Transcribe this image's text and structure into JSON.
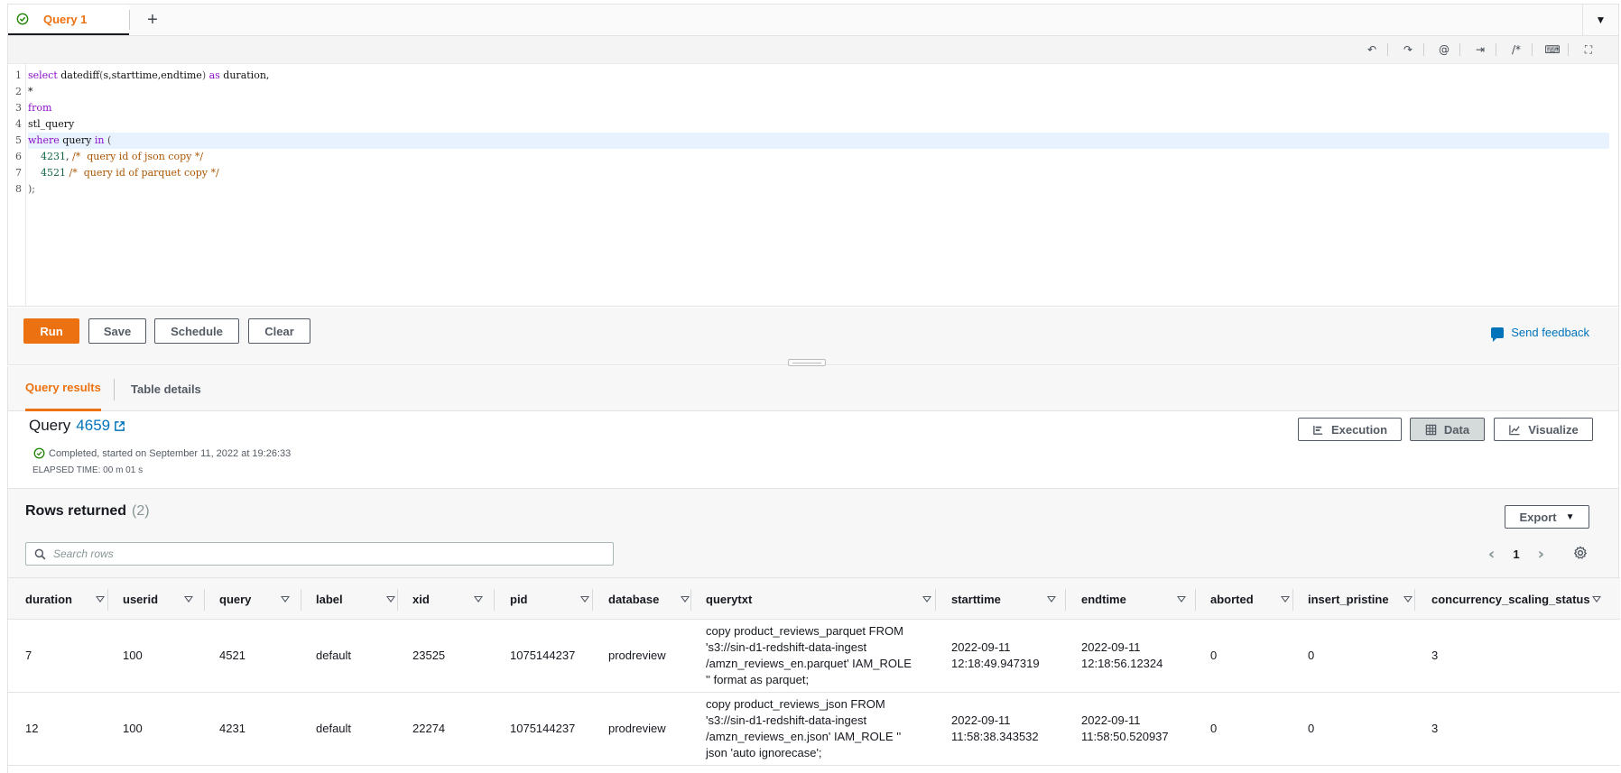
{
  "tabs": {
    "active_label": "Query 1",
    "add_label": "+",
    "menu_label": "▼"
  },
  "editor": {
    "toolbar": {
      "undo": "↶",
      "redo": "↷",
      "at": "@",
      "indent": "⇥",
      "comment": "/*",
      "keyboard": "⌨",
      "fullscreen": "⛶"
    },
    "lines": [
      {
        "num": "1"
      },
      {
        "num": "2"
      },
      {
        "num": "3"
      },
      {
        "num": "4"
      },
      {
        "num": "5"
      },
      {
        "num": "6"
      },
      {
        "num": "7"
      },
      {
        "num": "8"
      }
    ],
    "code": {
      "l1_kw1": "select",
      "l1_fn": " datediff",
      "l1_open": "(",
      "l1_args": "s,starttime,endtime",
      "l1_close": ")",
      "l1_as": " as",
      "l1_rest": " duration,",
      "l2": "*",
      "l3_kw": "from",
      "l4": "stl_query",
      "l5_kw1": "where",
      "l5_mid": " query ",
      "l5_kw2": "in",
      "l5_paren": " (",
      "l6_num": "4231",
      "l6_comma": ", ",
      "l6_cmt": "/*  query id of json copy */",
      "l7_num": "4521",
      "l7_cmt": " /*  query id of parquet copy */",
      "l8": ");"
    }
  },
  "actions": {
    "run": "Run",
    "save": "Save",
    "schedule": "Schedule",
    "clear": "Clear",
    "feedback": "Send feedback"
  },
  "result_tabs": {
    "query_results": "Query results",
    "table_details": "Table details"
  },
  "query_summary": {
    "title_prefix": "Query",
    "query_id": "4659",
    "status": "Completed, started on September 11, 2022 at 19:26:33",
    "elapsed": "ELAPSED TIME: 00 m 01 s",
    "execution_label": "Execution",
    "data_label": "Data",
    "visualize_label": "Visualize"
  },
  "rows": {
    "title": "Rows returned",
    "count": "(2)",
    "export_label": "Export",
    "search_placeholder": "Search rows",
    "page": "1",
    "prev": "‹",
    "next": "›"
  },
  "table": {
    "columns": [
      "duration",
      "userid",
      "query",
      "label",
      "xid",
      "pid",
      "database",
      "querytxt",
      "starttime",
      "endtime",
      "aborted",
      "insert_pristine",
      "concurrency_scaling_status"
    ],
    "rows": [
      {
        "duration": "7",
        "userid": "100",
        "query": "4521",
        "label": "default",
        "xid": "23525",
        "pid": "1075144237",
        "database": "prodreview",
        "querytxt": "copy product_reviews_parquet FROM 's3://sin-d1-redshift-data-ingest /amzn_reviews_en.parquet' IAM_ROLE '' format as parquet;",
        "starttime": "2022-09-11 12:18:49.947319",
        "endtime": "2022-09-11 12:18:56.12324",
        "aborted": "0",
        "insert_pristine": "0",
        "concurrency_scaling_status": "3"
      },
      {
        "duration": "12",
        "userid": "100",
        "query": "4231",
        "label": "default",
        "xid": "22274",
        "pid": "1075144237",
        "database": "prodreview",
        "querytxt": "copy product_reviews_json FROM 's3://sin-d1-redshift-data-ingest /amzn_reviews_en.json' IAM_ROLE '' json 'auto ignorecase';",
        "starttime": "2022-09-11 11:58:38.343532",
        "endtime": "2022-09-11 11:58:50.520937",
        "aborted": "0",
        "insert_pristine": "0",
        "concurrency_scaling_status": "3"
      }
    ]
  },
  "colors": {
    "accent": "#ec7211",
    "link": "#0073bb",
    "success": "#1d8102"
  }
}
